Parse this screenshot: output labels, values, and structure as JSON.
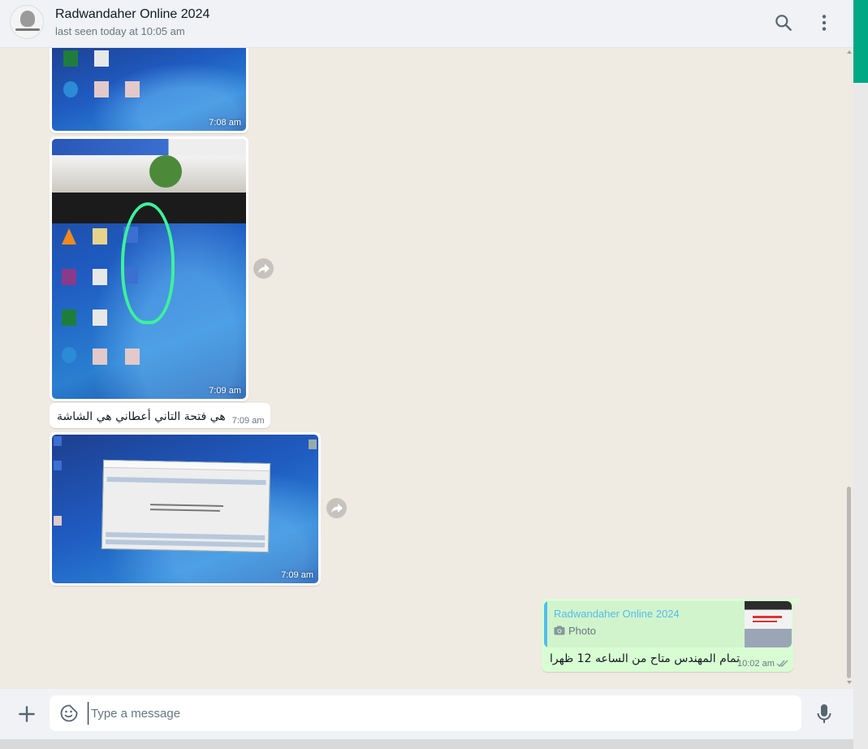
{
  "header": {
    "contact_name": "Radwandaher Online 2024",
    "status": "last seen today at 10:05 am",
    "icons": [
      "search-icon",
      "more-vertical-icon"
    ]
  },
  "messages": [
    {
      "type": "image",
      "direction": "incoming",
      "time": "7:08 am"
    },
    {
      "type": "image",
      "direction": "incoming",
      "time": "7:09 am"
    },
    {
      "type": "text",
      "direction": "incoming",
      "text": "هي فتحة التاني أعطاني هي الشاشة",
      "time": "7:09 am"
    },
    {
      "type": "image",
      "direction": "incoming",
      "time": "7:09 am"
    },
    {
      "type": "reply",
      "direction": "outgoing",
      "quote": {
        "name": "Radwandaher Online 2024",
        "media_label": "Photo"
      },
      "text": "تمام المهندس متاح من الساعه 12 ظهرا",
      "time": "10:02 am",
      "status": "read"
    }
  ],
  "composer": {
    "placeholder": "Type a message"
  },
  "colors": {
    "accent": "#00a884",
    "outgoing_bubble": "#d9fdd3",
    "quote_name": "#53bdeb",
    "chat_background": "#efeae2"
  }
}
